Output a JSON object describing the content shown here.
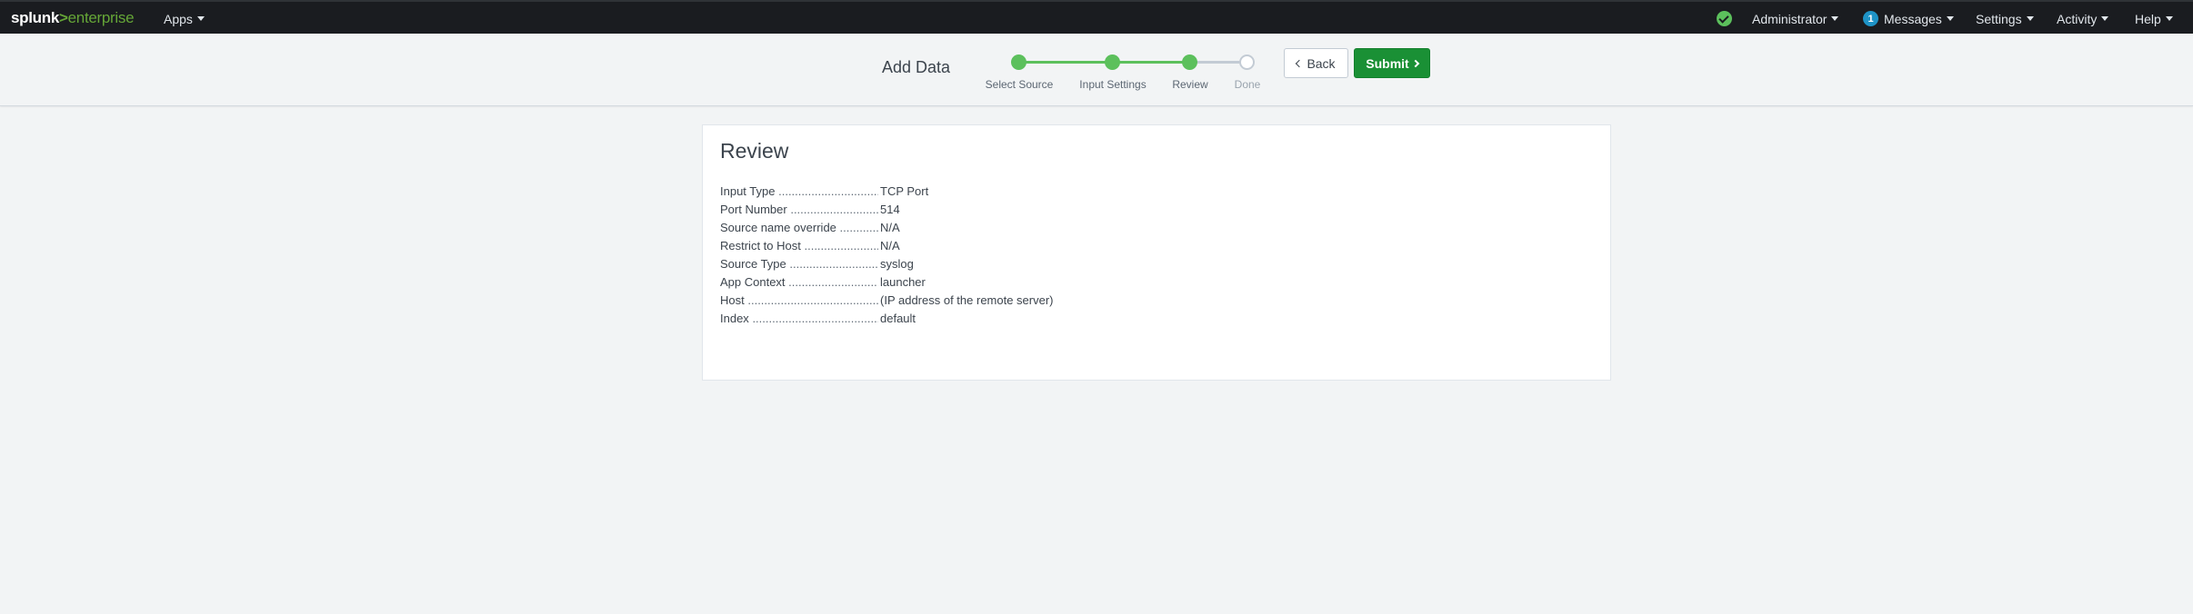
{
  "brand": {
    "splunk": "splunk",
    "separator": ">",
    "product": "enterprise"
  },
  "nav": {
    "apps": "Apps",
    "administrator": "Administrator",
    "messages_count": "1",
    "messages": "Messages",
    "settings": "Settings",
    "activity": "Activity",
    "help": "Help"
  },
  "wizard": {
    "title": "Add Data",
    "steps": [
      {
        "label": "Select Source",
        "state": "complete"
      },
      {
        "label": "Input Settings",
        "state": "complete"
      },
      {
        "label": "Review",
        "state": "current"
      },
      {
        "label": "Done",
        "state": "pending"
      }
    ],
    "back_label": "Back",
    "submit_label": "Submit"
  },
  "review": {
    "title": "Review",
    "rows": [
      {
        "key": "Input Type",
        "value": "TCP Port"
      },
      {
        "key": "Port Number",
        "value": "514"
      },
      {
        "key": "Source name override",
        "value": "N/A"
      },
      {
        "key": "Restrict to Host",
        "value": "N/A"
      },
      {
        "key": "Source Type",
        "value": "syslog"
      },
      {
        "key": "App Context",
        "value": "launcher"
      },
      {
        "key": "Host",
        "value": "(IP address of the remote server)"
      },
      {
        "key": "Index",
        "value": "default"
      }
    ]
  },
  "colors": {
    "topbar": "#1a1c20",
    "brand_green": "#65a637",
    "step_complete": "#5cc05c",
    "submit_button": "#1a9035",
    "message_badge": "#1e93c6"
  },
  "icons": {
    "health_status": "check-circle-icon",
    "back": "chevron-left-icon",
    "submit": "chevron-right-icon",
    "dropdown": "caret-down-icon"
  }
}
